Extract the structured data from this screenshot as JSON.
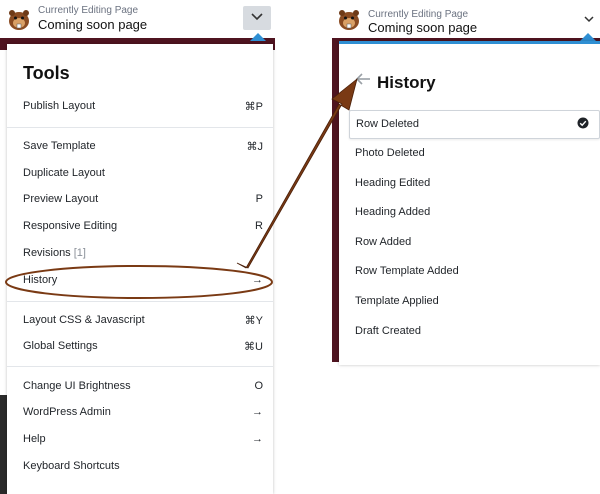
{
  "left_panel": {
    "header": {
      "label": "Currently Editing Page",
      "page_name": "Coming soon page",
      "toggle_icon": "chevron-down-icon"
    },
    "tools": {
      "title": "Tools",
      "items": [
        {
          "label": "Publish Layout",
          "shortcut": "⌘P"
        },
        {
          "label": "Save Template",
          "shortcut": "⌘J"
        },
        {
          "label": "Duplicate Layout",
          "shortcut": ""
        },
        {
          "label": "Preview Layout",
          "shortcut": "P"
        },
        {
          "label": "Responsive Editing",
          "shortcut": "R"
        },
        {
          "label": "Revisions",
          "count": "[1]",
          "shortcut": ""
        },
        {
          "label": "History",
          "shortcut": "→"
        },
        {
          "label": "Layout CSS & Javascript",
          "shortcut": "⌘Y"
        },
        {
          "label": "Global Settings",
          "shortcut": "⌘U"
        },
        {
          "label": "Change UI Brightness",
          "shortcut": "O"
        },
        {
          "label": "WordPress Admin",
          "shortcut": "→"
        },
        {
          "label": "Help",
          "shortcut": "→"
        },
        {
          "label": "Keyboard Shortcuts",
          "shortcut": ""
        }
      ]
    }
  },
  "right_panel": {
    "header": {
      "label": "Currently Editing Page",
      "page_name": "Coming soon page",
      "toggle_icon": "chevron-down-icon"
    },
    "history": {
      "title": "History",
      "back_icon": "arrow-left-icon",
      "items": [
        {
          "label": "Row Deleted",
          "active": true
        },
        {
          "label": "Photo Deleted"
        },
        {
          "label": "Heading Edited"
        },
        {
          "label": "Heading Added"
        },
        {
          "label": "Row Added"
        },
        {
          "label": "Row Template Added"
        },
        {
          "label": "Template Applied"
        },
        {
          "label": "Draft Created"
        }
      ]
    }
  },
  "annotation": {
    "highlight": "History",
    "arrow_color": "#7a3a14"
  },
  "colors": {
    "accent": "#2f8fd3",
    "page_background": "#4f1420",
    "annotation": "#7a3a14"
  }
}
